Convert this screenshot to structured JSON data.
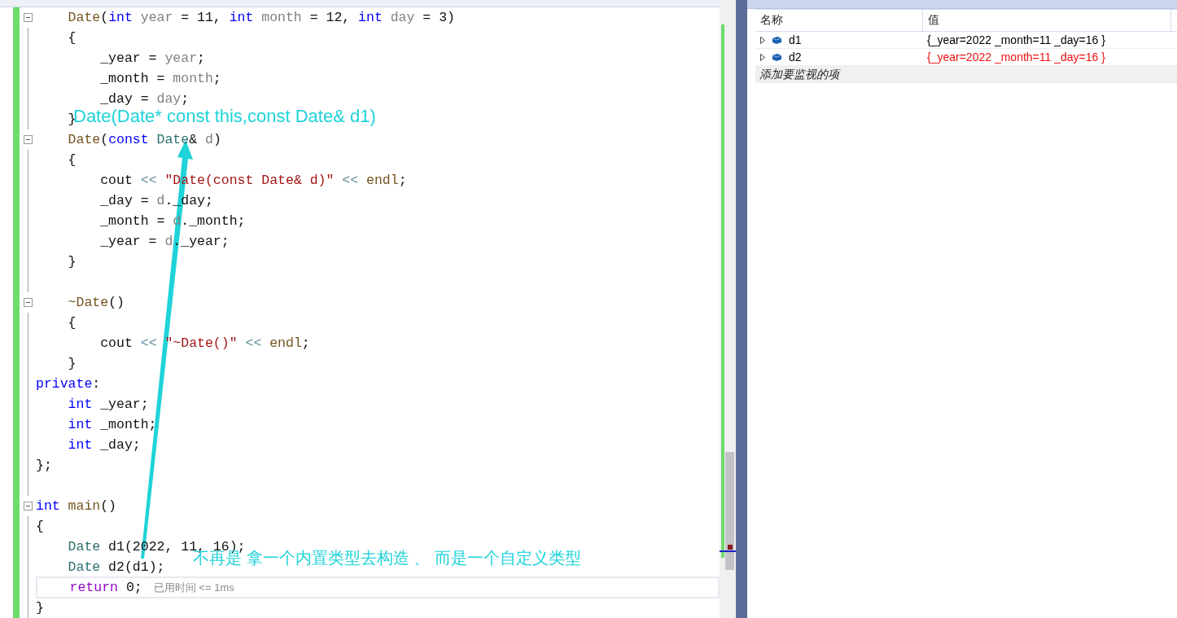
{
  "editor": {
    "lines": [
      {
        "fold": true,
        "tokens": [
          {
            "t": "    Date",
            "kind": "fn"
          },
          {
            "t": "("
          },
          {
            "t": "int ",
            "kind": "kw"
          },
          {
            "t": "year",
            "kind": "param"
          },
          {
            "t": " = 11, "
          },
          {
            "t": "int ",
            "kind": "kw"
          },
          {
            "t": "month",
            "kind": "param"
          },
          {
            "t": " = 12, "
          },
          {
            "t": "int ",
            "kind": "kw"
          },
          {
            "t": "day",
            "kind": "param"
          },
          {
            "t": " = 3)"
          }
        ]
      },
      {
        "fold": false,
        "tokens": [
          {
            "t": "    {"
          }
        ]
      },
      {
        "fold": false,
        "tokens": [
          {
            "t": "        _year = "
          },
          {
            "t": "year",
            "kind": "param"
          },
          {
            "t": ";"
          }
        ]
      },
      {
        "fold": false,
        "tokens": [
          {
            "t": "        _month = "
          },
          {
            "t": "month",
            "kind": "param"
          },
          {
            "t": ";"
          }
        ]
      },
      {
        "fold": false,
        "tokens": [
          {
            "t": "        _day = "
          },
          {
            "t": "day",
            "kind": "param"
          },
          {
            "t": ";"
          }
        ]
      },
      {
        "fold": false,
        "tokens": [
          {
            "t": "    }"
          }
        ]
      },
      {
        "fold": true,
        "tokens": [
          {
            "t": "    Date",
            "kind": "fn"
          },
          {
            "t": "("
          },
          {
            "t": "const ",
            "kind": "kw"
          },
          {
            "t": "Date",
            "kind": "type"
          },
          {
            "t": "& "
          },
          {
            "t": "d",
            "kind": "param"
          },
          {
            "t": ")"
          }
        ]
      },
      {
        "fold": false,
        "tokens": [
          {
            "t": "    {"
          }
        ]
      },
      {
        "fold": false,
        "tokens": [
          {
            "t": "        cout "
          },
          {
            "t": "<< ",
            "kind": "op"
          },
          {
            "t": "\"Date(const Date& d)\"",
            "kind": "str"
          },
          {
            "t": " <<",
            "kind": "op"
          },
          {
            "t": " endl",
            "kind": "fn"
          },
          {
            "t": ";"
          }
        ]
      },
      {
        "fold": false,
        "tokens": [
          {
            "t": "        _day = "
          },
          {
            "t": "d",
            "kind": "param"
          },
          {
            "t": "._day;"
          }
        ]
      },
      {
        "fold": false,
        "tokens": [
          {
            "t": "        _month = "
          },
          {
            "t": "d",
            "kind": "param"
          },
          {
            "t": "._month;"
          }
        ]
      },
      {
        "fold": false,
        "tokens": [
          {
            "t": "        _year = "
          },
          {
            "t": "d",
            "kind": "param"
          },
          {
            "t": "._year;"
          }
        ]
      },
      {
        "fold": false,
        "tokens": [
          {
            "t": "    }"
          }
        ]
      },
      {
        "fold": false
      },
      {
        "fold": true,
        "tokens": [
          {
            "t": "    ~Date",
            "kind": "fn"
          },
          {
            "t": "()"
          }
        ]
      },
      {
        "fold": false,
        "tokens": [
          {
            "t": "    {"
          }
        ]
      },
      {
        "fold": false,
        "tokens": [
          {
            "t": "        cout "
          },
          {
            "t": "<< ",
            "kind": "op"
          },
          {
            "t": "\"~Date()\"",
            "kind": "str"
          },
          {
            "t": " <<",
            "kind": "op"
          },
          {
            "t": " endl",
            "kind": "fn"
          },
          {
            "t": ";"
          }
        ]
      },
      {
        "fold": false,
        "tokens": [
          {
            "t": "    }"
          }
        ]
      },
      {
        "fold": false,
        "tokens": [
          {
            "t": "private",
            "kind": "kw"
          },
          {
            "t": ":"
          }
        ]
      },
      {
        "fold": false,
        "tokens": [
          {
            "t": "    int",
            "kind": "kw"
          },
          {
            "t": " _year;"
          }
        ]
      },
      {
        "fold": false,
        "tokens": [
          {
            "t": "    int",
            "kind": "kw"
          },
          {
            "t": " _month;"
          }
        ]
      },
      {
        "fold": false,
        "tokens": [
          {
            "t": "    int",
            "kind": "kw"
          },
          {
            "t": " _day;"
          }
        ]
      },
      {
        "fold": false,
        "tokens": [
          {
            "t": "};"
          }
        ]
      },
      {
        "fold": false
      },
      {
        "fold": true,
        "tokens": [
          {
            "t": "int ",
            "kind": "kw"
          },
          {
            "t": "main",
            "kind": "fn"
          },
          {
            "t": "()"
          }
        ]
      },
      {
        "fold": false,
        "tokens": [
          {
            "t": "{"
          }
        ]
      },
      {
        "fold": false,
        "tokens": [
          {
            "t": "    Date",
            "kind": "type"
          },
          {
            "t": " d1(2022, 11, 16);"
          }
        ]
      },
      {
        "fold": false,
        "tokens": [
          {
            "t": "    Date",
            "kind": "type"
          },
          {
            "t": " d2(d1);"
          }
        ]
      },
      {
        "fold": false,
        "current": true,
        "tokens": [
          {
            "t": "    return",
            "kind": "ctl"
          },
          {
            "t": " 0;"
          }
        ],
        "hint": "已用时间 <= 1ms"
      },
      {
        "fold": false,
        "tokens": [
          {
            "t": "}"
          }
        ]
      }
    ],
    "annotations": [
      {
        "kind": "signature",
        "text": "Date(Date* const this,const Date& d1)"
      },
      {
        "kind": "note",
        "text": "不再是 拿一个内置类型去构造 、 而是一个自定义类型"
      }
    ]
  },
  "watch": {
    "columns": [
      "名称",
      "值"
    ],
    "rows": [
      {
        "name": "d1",
        "value": "{_year=2022 _month=11 _day=16 }",
        "changed": false,
        "expanded": false
      },
      {
        "name": "d2",
        "value": "{_year=2022 _month=11 _day=16 }",
        "changed": true,
        "expanded": false
      }
    ],
    "add_item": "添加要监视的项"
  }
}
